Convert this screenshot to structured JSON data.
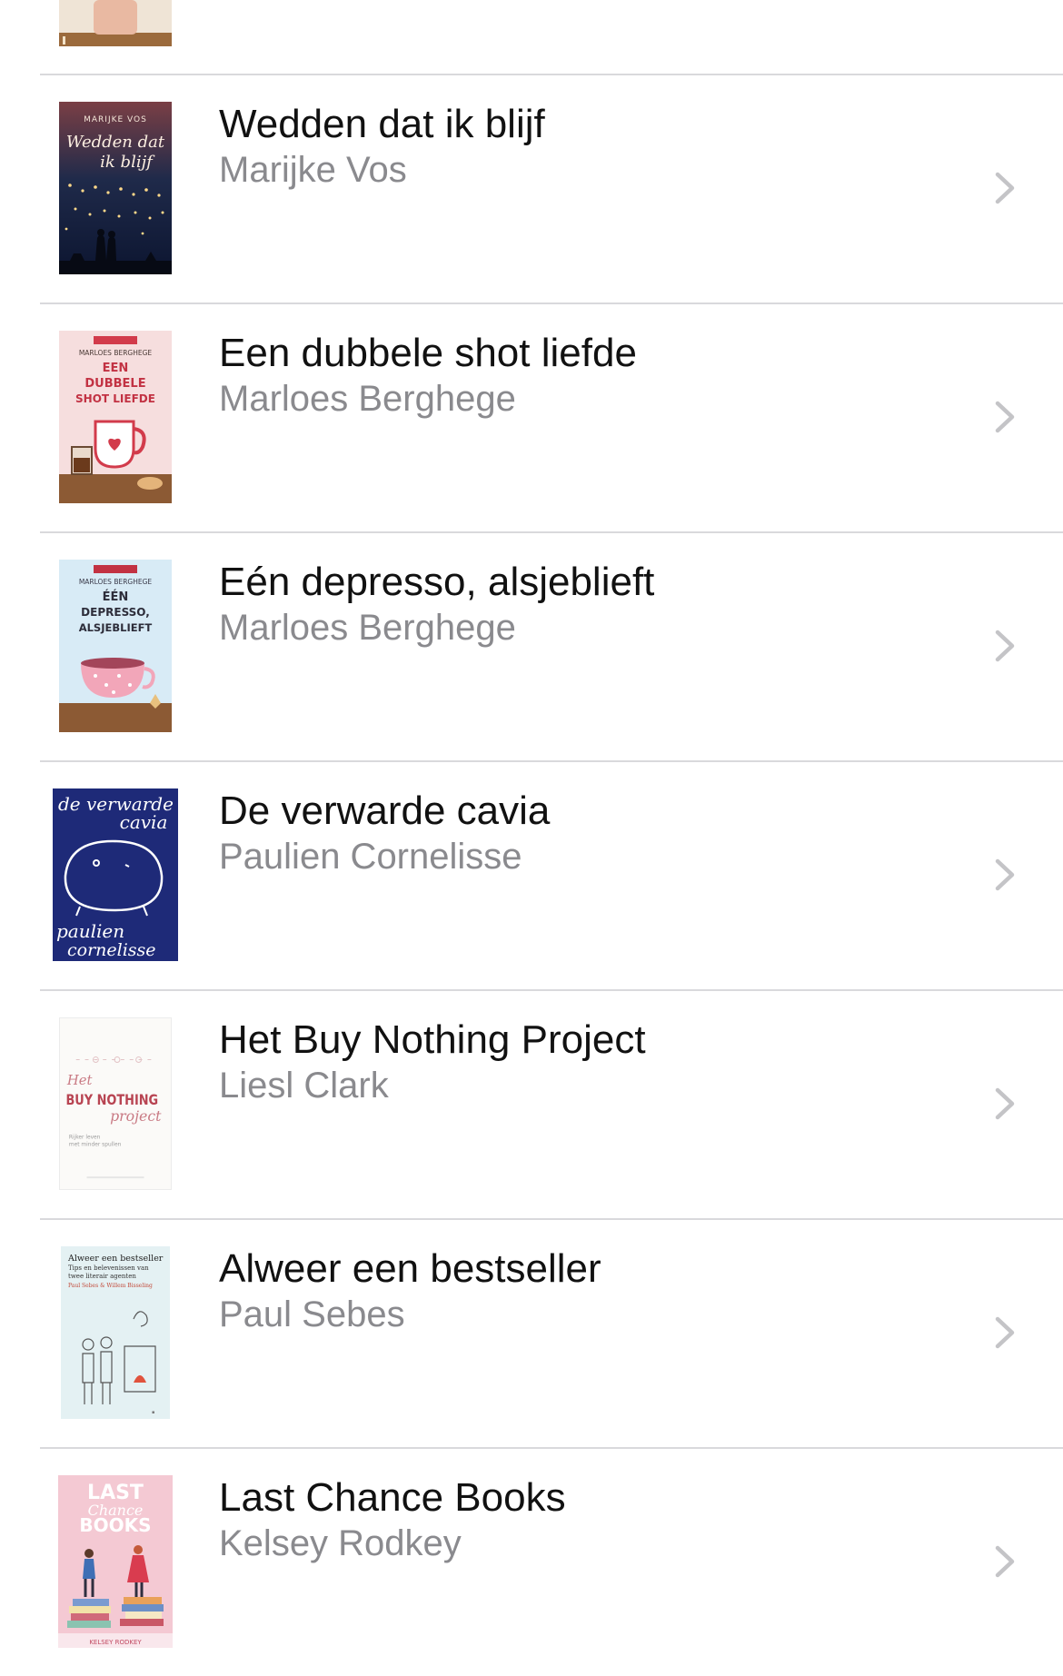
{
  "books": [
    {
      "title": "Wedden dat ik blijf",
      "author": "Marijke Vos",
      "cover": {
        "author": "MARIJKE VOS",
        "line1": "Wedden dat",
        "line2": "ik blijf"
      }
    },
    {
      "title": "Een dubbele shot liefde",
      "author": "Marloes Berghege",
      "cover": {
        "author": "MARLOES BERGHEGE",
        "line1": "EEN",
        "line2": "DUBBELE",
        "line3": "SHOT LIEFDE"
      }
    },
    {
      "title": "Eén depresso, alsjeblieft",
      "author": "Marloes Berghege",
      "cover": {
        "author": "MARLOES BERGHEGE",
        "line1": "ÉÉN",
        "line2": "DEPRESSO,",
        "line3": "ALSJEBLIEFT"
      }
    },
    {
      "title": "De verwarde cavia",
      "author": "Paulien Cornelisse",
      "cover": {
        "line1": "de verwarde",
        "line2": "cavia",
        "line3": "paulien",
        "line4": "cornelisse"
      }
    },
    {
      "title": "Het Buy Nothing Project",
      "author": "Liesl Clark",
      "cover": {
        "line1": "Het",
        "line2": "BUY NOTHING",
        "line3": "project",
        "line4": "Rijker leven",
        "line5": "met minder spullen"
      }
    },
    {
      "title": "Alweer een bestseller",
      "author": "Paul Sebes",
      "cover": {
        "line1": "Alweer een bestseller",
        "line2": "Tips en belevenissen van",
        "line3": "twee literair agenten",
        "line4": "Paul Sebes & Willem Bisseling"
      }
    },
    {
      "title": "Last Chance Books",
      "author": "Kelsey Rodkey",
      "cover": {
        "line1": "LAST",
        "line2": "Chance",
        "line3": "BOOKS",
        "line4": "KELSEY RODKEY"
      }
    }
  ],
  "chevron_icon": "chevron-right-icon",
  "colors": {
    "title": "#111111",
    "subtitle": "#8a8a8e",
    "separator": "#d9d9dc",
    "chevron": "#c4c4c7"
  }
}
